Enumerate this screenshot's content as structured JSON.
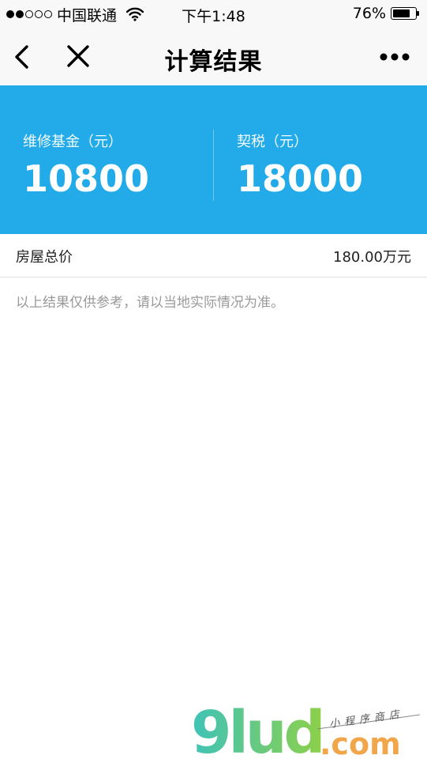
{
  "status_bar": {
    "carrier": "中国联通",
    "time": "下午1:48",
    "battery": "76%",
    "battery_level": 0.76,
    "signal_bars_filled": 2,
    "signal_bars_total": 5
  },
  "nav": {
    "title": "计算结果",
    "back_icon": "chevron-left-icon",
    "close_icon": "close-icon",
    "more_icon": "more-dots-icon"
  },
  "results": [
    {
      "label": "维修基金（元）",
      "value": "10800"
    },
    {
      "label": "契税（元）",
      "value": "18000"
    }
  ],
  "detail": {
    "label": "房屋总价",
    "value": "180.00万元"
  },
  "note": "以上结果仅供参考，请以当地实际情况为准。",
  "watermark": {
    "brand": "9lud",
    "domain": ".com",
    "tagline": "小程序商店"
  },
  "colors": {
    "banner": "#22abe8",
    "watermark_green": "#8dd04a",
    "watermark_teal": "#3fc3b8",
    "watermark_orange": "#f2a64a"
  }
}
